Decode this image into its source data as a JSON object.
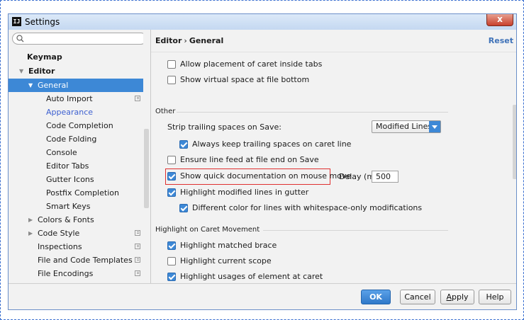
{
  "window": {
    "title": "Settings",
    "app_icon_text": "IJ",
    "close_label": "x"
  },
  "search": {
    "placeholder": ""
  },
  "sidebar": {
    "items": [
      {
        "label": "Keymap"
      },
      {
        "label": "Editor"
      },
      {
        "label": "General"
      },
      {
        "label": "Auto Import"
      },
      {
        "label": "Appearance"
      },
      {
        "label": "Code Completion"
      },
      {
        "label": "Code Folding"
      },
      {
        "label": "Console"
      },
      {
        "label": "Editor Tabs"
      },
      {
        "label": "Gutter Icons"
      },
      {
        "label": "Postfix Completion"
      },
      {
        "label": "Smart Keys"
      },
      {
        "label": "Colors & Fonts"
      },
      {
        "label": "Code Style"
      },
      {
        "label": "Inspections"
      },
      {
        "label": "File and Code Templates"
      },
      {
        "label": "File Encodings"
      }
    ],
    "selected": "General",
    "highlighted_link_color": "#3c5fd0"
  },
  "content": {
    "breadcrumb": {
      "parent": "Editor",
      "separator": "›",
      "current": "General"
    },
    "reset_label": "Reset",
    "top_options": [
      {
        "label": "Allow placement of caret inside tabs",
        "checked": false
      },
      {
        "label": "Show virtual space at file bottom",
        "checked": false
      }
    ],
    "other": {
      "section_title": "Other",
      "strip_label": "Strip trailing spaces on Save:",
      "strip_value": "Modified Lines",
      "keep_trailing": "Always keep trailing spaces on caret line",
      "ensure_line_feed": "Ensure line feed at file end on Save",
      "quick_doc": "Show quick documentation on mouse move",
      "delay_label": "Delay (ms):",
      "delay_value": "500",
      "highlight_modified": "Highlight modified lines in gutter",
      "different_color": "Different color for lines with whitespace-only modifications"
    },
    "caret": {
      "section_title": "Highlight on Caret Movement",
      "matched_brace": "Highlight matched brace",
      "current_scope": "Highlight current scope",
      "usages": "Highlight usages of element at caret"
    }
  },
  "footer": {
    "ok": "OK",
    "cancel": "Cancel",
    "apply_mnemonic": "A",
    "apply_rest": "pply",
    "help": "Help"
  },
  "colors": {
    "accent": "#3d88d6",
    "highlight_border": "#e03030",
    "link": "#3f72b8"
  }
}
